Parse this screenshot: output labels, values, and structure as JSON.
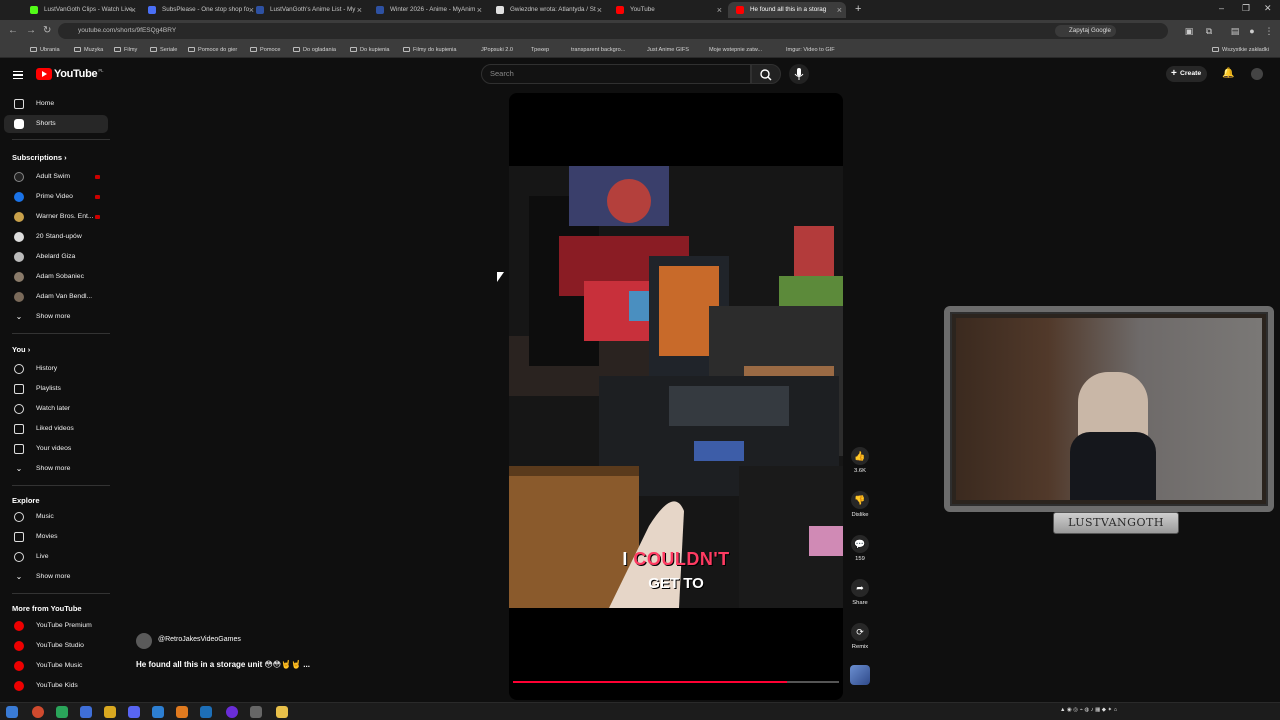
{
  "browser": {
    "tabs": [
      {
        "label": "LustVanGoth Clips - Watch Live",
        "color": "#53fc18"
      },
      {
        "label": "SubsPlease - One stop shop fo",
        "color": "#4a6ff5"
      },
      {
        "label": "LustVanGoth's Anime List - My",
        "color": "#2e51a2"
      },
      {
        "label": "Winter 2026 - Anime - MyAnim",
        "color": "#2e51a2"
      },
      {
        "label": "Gwiezdne wrota: Atlantyda / St",
        "color": "#e0e0e0"
      },
      {
        "label": "YouTube",
        "color": "#ff0000"
      },
      {
        "label": "He found all this in a storag",
        "color": "#ff0000"
      }
    ],
    "url": "youtube.com/shorts/9fESQg4BRY",
    "google_lens": "Zapytaj Google",
    "bookmarks": [
      "Ubrania",
      "Muzyka",
      "Filmy",
      "Seriale",
      "Pomoce do gier",
      "Pomoce",
      "Do ogladania",
      "Do kupienia",
      "Filmy do kupienia",
      "JPopsuki 2.0",
      "Трекер",
      "transparent backgro...",
      "Just Anime GIFS",
      "Moje wstepnie zatw...",
      "Imgur: Video to GIF"
    ],
    "bookmarks_all": "Wszystkie zakładki"
  },
  "youtube": {
    "brand": "YouTube",
    "country": "PL",
    "search_placeholder": "Search",
    "create_label": "Create",
    "sidebar": {
      "main": [
        {
          "label": "Home"
        },
        {
          "label": "Shorts"
        }
      ],
      "subscriptions_title": "Subscriptions",
      "subscriptions": [
        {
          "label": "Adult Swim"
        },
        {
          "label": "Prime Video"
        },
        {
          "label": "Warner Bros. Ent..."
        },
        {
          "label": "20 Stand-upów"
        },
        {
          "label": "Abelard Giza"
        },
        {
          "label": "Adam Sobaniec"
        },
        {
          "label": "Adam Van Bendl..."
        }
      ],
      "show_more": "Show more",
      "you_title": "You",
      "you": [
        {
          "label": "History"
        },
        {
          "label": "Playlists"
        },
        {
          "label": "Watch later"
        },
        {
          "label": "Liked videos"
        },
        {
          "label": "Your videos"
        }
      ],
      "explore_title": "Explore",
      "explore": [
        {
          "label": "Music"
        },
        {
          "label": "Movies"
        },
        {
          "label": "Live"
        }
      ],
      "more_title": "More from YouTube",
      "more": [
        {
          "label": "YouTube Premium"
        },
        {
          "label": "YouTube Studio"
        },
        {
          "label": "YouTube Music"
        },
        {
          "label": "YouTube Kids"
        }
      ]
    },
    "short": {
      "caption_word1": "I",
      "caption_word2": "COULDN'T",
      "caption_line2": "GET TO",
      "progress": 0.84,
      "channel": "@RetroJakesVideoGames",
      "title": "He found all this in a storage unit 😳😳🤘🤘 ...",
      "actions": {
        "likes": "3.6K",
        "dislike": "Dislike",
        "comments": "159",
        "share": "Share",
        "remix": "Remix"
      }
    }
  },
  "overlay": {
    "nameplate": "LUSTVANGOTH"
  }
}
